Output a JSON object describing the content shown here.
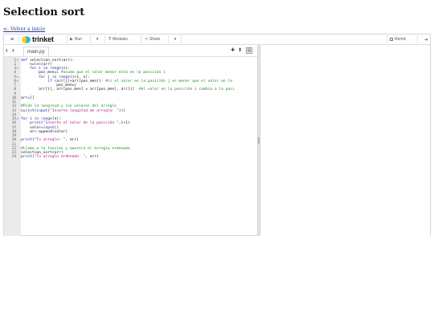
{
  "page": {
    "title": "Selection sort",
    "back_link": "<- Volver a inicio"
  },
  "toolbar": {
    "brand": "trinket",
    "run": "Run",
    "modules": "Modules",
    "share": "Share",
    "remix": "Remix"
  },
  "editor": {
    "filename": "main.py",
    "lines": [
      {
        "n": "1",
        "fold": true,
        "text": "def selection_sort(arr):"
      },
      {
        "n": "2",
        "fold": false,
        "text": "    n=len(arr)"
      },
      {
        "n": "3",
        "fold": true,
        "text": "    for i in range(n):"
      },
      {
        "n": "4",
        "fold": false,
        "text": "        pos_men=i #asume que el valor menor está en la posición i"
      },
      {
        "n": "5",
        "fold": true,
        "text": "        for j in range(i+1, n):"
      },
      {
        "n": "6",
        "fold": true,
        "text": "            if (arr[j]<arr[pos_men]): #si el valor en la posición j es menor que el valor en la"
      },
      {
        "n": "7",
        "fold": false,
        "text": "                pos_men=j"
      },
      {
        "n": "8",
        "fold": false,
        "text": "        arr[i], arr[pos_men] = arr[pos_men], arr[i]  #el valor en la posición i cambia a la posi"
      },
      {
        "n": "9",
        "fold": false,
        "text": ""
      },
      {
        "n": "10",
        "fold": false,
        "text": "arr=[]"
      },
      {
        "n": "11",
        "fold": false,
        "text": ""
      },
      {
        "n": "12",
        "fold": false,
        "text": "#Pide la longitud y los valores del arreglo"
      },
      {
        "n": "13",
        "fold": false,
        "text": "n=(int(input(\"Inserte longitud de arreglo: \")))"
      },
      {
        "n": "14",
        "fold": false,
        "text": ""
      },
      {
        "n": "15",
        "fold": true,
        "text": "for i in range(n):"
      },
      {
        "n": "16",
        "fold": false,
        "text": "    print(\"Inserte el valor de la posición \",i+1)"
      },
      {
        "n": "17",
        "fold": false,
        "text": "    valor=input()"
      },
      {
        "n": "18",
        "fold": false,
        "text": "    arr.append(valor)"
      },
      {
        "n": "19",
        "fold": false,
        "text": ""
      },
      {
        "n": "20",
        "fold": false,
        "text": "print(\"Tu arreglo: \", arr)"
      },
      {
        "n": "21",
        "fold": false,
        "text": ""
      },
      {
        "n": "22",
        "fold": false,
        "text": "#Llama a la función y muestra el arreglo ordenado"
      },
      {
        "n": "23",
        "fold": false,
        "text": "selection_sort(arr)"
      },
      {
        "n": "24",
        "fold": false,
        "text": "print(\"Tu arreglo ordenado: \", arr)"
      }
    ]
  },
  "icons": {
    "menu": "hamburger-menu-icon",
    "run": "play-icon",
    "modules": "question-icon",
    "share": "share-icon",
    "remix": "remix-icon",
    "signin": "sign-in-icon",
    "add_file": "plus-icon",
    "upload": "upload-icon",
    "file": "file-icon"
  },
  "colors": {
    "keyword": "#1919c8",
    "string": "#b0157c",
    "comment": "#1f8a1f",
    "gutter": "#ebebeb",
    "link": "#1a35c8"
  }
}
